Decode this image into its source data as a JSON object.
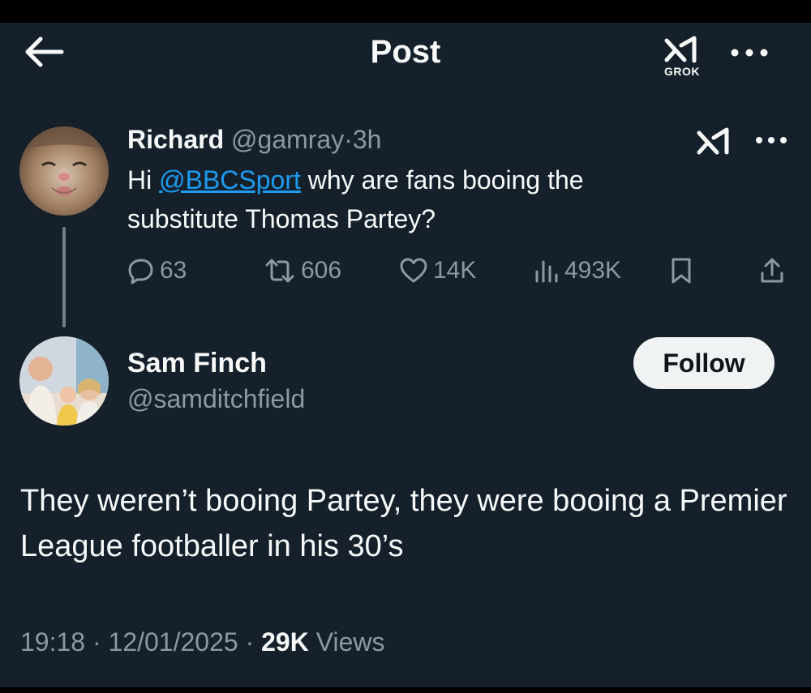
{
  "header": {
    "title": "Post",
    "grok_label": "GROK",
    "back_icon": "back-arrow-icon",
    "more_icon": "more-dots-icon"
  },
  "parent_post": {
    "author_name": "Richard",
    "handle": "@gamray",
    "separator": "·",
    "time_ago": "3h",
    "text_before": "Hi ",
    "mention": "@BBCSport",
    "text_after": " why are fans booing the substitute Thomas Partey?",
    "stats": {
      "replies": "63",
      "reposts": "606",
      "likes": "14K",
      "views": "493K"
    }
  },
  "reply": {
    "author_name": "Sam Finch",
    "handle": "@samditchfield",
    "follow_label": "Follow",
    "text": "They weren’t booing Partey, they were booing a Premier League footballer in his 30’s",
    "time": "19:18",
    "date": "12/01/2025",
    "separator": "·",
    "views_count": "29K",
    "views_label": "Views"
  },
  "colors": {
    "background": "#15202b",
    "text": "#f7f9f9",
    "muted": "#8b98a5",
    "link": "#1d9bf0",
    "follow_bg": "#eff3f4"
  }
}
